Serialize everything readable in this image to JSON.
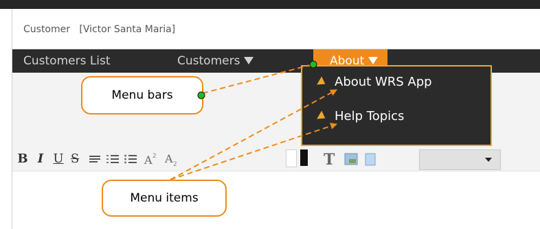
{
  "window": {
    "title": "Customer   [Victor Santa Maria]"
  },
  "menubar": {
    "items": [
      {
        "label": "Customers List",
        "has_dropdown": false
      },
      {
        "label": "Customers",
        "has_dropdown": true
      },
      {
        "label": "About",
        "has_dropdown": true,
        "active": true
      }
    ]
  },
  "dropdown": {
    "items": [
      {
        "label": "About WRS App"
      },
      {
        "label": "Help Topics"
      }
    ]
  },
  "toolbar": {
    "bold": "B",
    "italic": "I",
    "underline": "U",
    "strike": "S",
    "text_style": "T",
    "icons": [
      "align-left-icon",
      "ordered-list-icon",
      "unordered-list-icon",
      "superscript-icon",
      "subscript-icon",
      "highlight-color-icon",
      "font-color-icon",
      "text-style-icon",
      "image-icon",
      "clipboard-icon"
    ],
    "color_select_value": ""
  },
  "callouts": {
    "menu_bars": "Menu bars",
    "menu_items": "Menu items"
  },
  "colors": {
    "accent": "#ef8b1c",
    "dropdown_border": "#f0a531",
    "menubar_bg": "#2b2b2b",
    "arrow_line": "#ef8b1c",
    "anchor_dot": "#22bb22"
  }
}
